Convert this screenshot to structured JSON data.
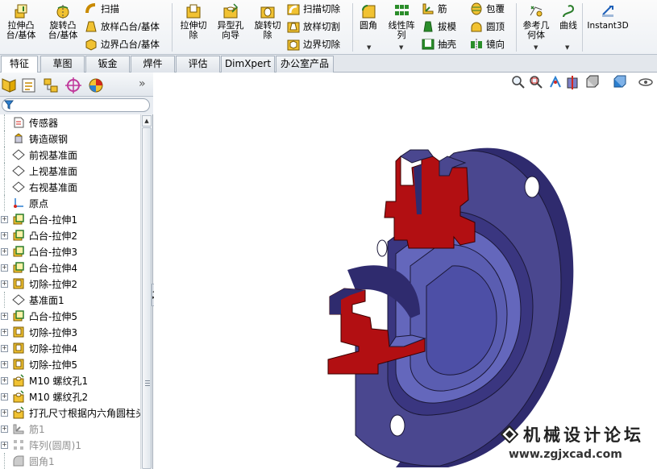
{
  "ribbon": {
    "extrude_boss": "拉伸凸\n台/基体",
    "revolve_boss": "旋转凸\n台/基体",
    "sweep": "扫描",
    "loft_boss": "放样凸台/基体",
    "boundary_boss": "边界凸台/基体",
    "extrude_cut": "拉伸切\n除",
    "hole_wizard": "异型孔\n向导",
    "revolve_cut": "旋转切\n除",
    "sweep_cut": "扫描切除",
    "loft_cut": "放样切割",
    "boundary_cut": "边界切除",
    "fillet": "圆角",
    "linear_pattern": "线性阵\n列",
    "rib": "筋",
    "draft": "拔模",
    "shell": "抽壳",
    "wrap": "包覆",
    "dome": "圆顶",
    "mirror": "镜向",
    "ref_geometry": "参考几\n何体",
    "curves": "曲线",
    "instant3d": "Instant3D"
  },
  "tabs": [
    "特征",
    "草图",
    "钣金",
    "焊件",
    "评估",
    "DimXpert",
    "办公室产品"
  ],
  "active_tab": "特征",
  "tree": {
    "items": [
      {
        "label": "传感器",
        "icon": "sensor-icon",
        "expandable": false
      },
      {
        "label": "铸造碳钢",
        "icon": "material-icon",
        "expandable": false
      },
      {
        "label": "前视基准面",
        "icon": "plane-icon",
        "expandable": false
      },
      {
        "label": "上视基准面",
        "icon": "plane-icon",
        "expandable": false
      },
      {
        "label": "右视基准面",
        "icon": "plane-icon",
        "expandable": false
      },
      {
        "label": "原点",
        "icon": "origin-icon",
        "expandable": false
      },
      {
        "label": "凸台-拉伸1",
        "icon": "boss-extrude-icon",
        "expandable": true
      },
      {
        "label": "凸台-拉伸2",
        "icon": "boss-extrude-icon",
        "expandable": true
      },
      {
        "label": "凸台-拉伸3",
        "icon": "boss-extrude-icon",
        "expandable": true
      },
      {
        "label": "凸台-拉伸4",
        "icon": "boss-extrude-icon",
        "expandable": true
      },
      {
        "label": "切除-拉伸2",
        "icon": "cut-extrude-icon",
        "expandable": true
      },
      {
        "label": "基准面1",
        "icon": "plane-icon",
        "expandable": false
      },
      {
        "label": "凸台-拉伸5",
        "icon": "boss-extrude-icon",
        "expandable": true
      },
      {
        "label": "切除-拉伸3",
        "icon": "cut-extrude-icon",
        "expandable": true
      },
      {
        "label": "切除-拉伸4",
        "icon": "cut-extrude-icon",
        "expandable": true
      },
      {
        "label": "切除-拉伸5",
        "icon": "cut-extrude-icon",
        "expandable": true
      },
      {
        "label": "M10 螺纹孔1",
        "icon": "hole-icon",
        "expandable": true
      },
      {
        "label": "M10 螺纹孔2",
        "icon": "hole-icon",
        "expandable": true
      },
      {
        "label": "打孔尺寸根据内六角圆柱头",
        "icon": "hole-icon",
        "expandable": true
      },
      {
        "label": "筋1",
        "icon": "rib-icon",
        "expandable": true,
        "suppressed": true
      },
      {
        "label": "阵列(圆周)1",
        "icon": "pattern-icon",
        "expandable": true,
        "suppressed": true
      },
      {
        "label": "圆角1",
        "icon": "fillet-icon",
        "expandable": false,
        "suppressed": true
      }
    ]
  },
  "watermark": {
    "title": "机械设计论坛",
    "url": "www.zgjxcad.com"
  },
  "colors": {
    "part_body": "#4a478f",
    "section_cut": "#b20f12",
    "accent_blue": "#1d5fb8"
  }
}
